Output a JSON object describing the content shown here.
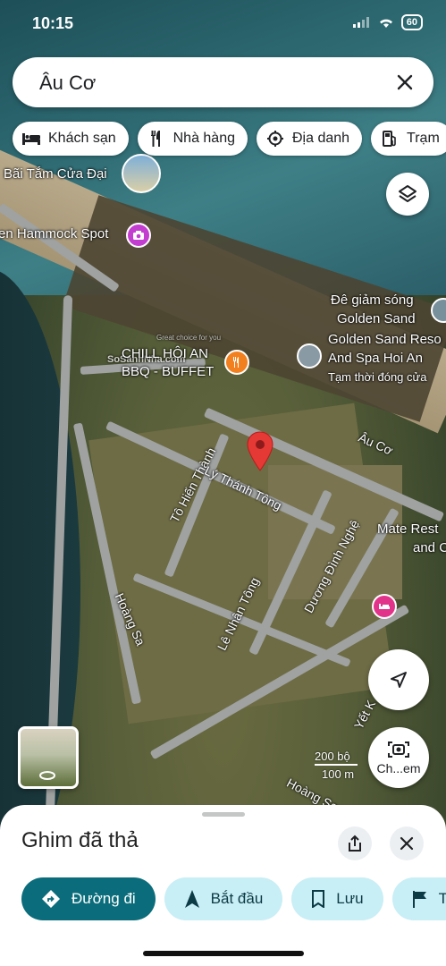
{
  "status_bar": {
    "time": "10:15",
    "battery": "60"
  },
  "search": {
    "query": "Âu Cơ"
  },
  "chips": [
    {
      "label": "Khách sạn",
      "icon": "bed-icon"
    },
    {
      "label": "Nhà hàng",
      "icon": "restaurant-icon"
    },
    {
      "label": "Địa danh",
      "icon": "landmark-icon"
    },
    {
      "label": "Trạm",
      "icon": "gas-station-icon"
    }
  ],
  "map": {
    "places": {
      "beach": "Bãi Tắm Cửa Đại",
      "hammock": "en Hammock Spot",
      "chill_line1": "CHILL HỘI AN",
      "chill_line2": "BBQ - BUFFET",
      "breakwater_line1": "Đê giảm sóng",
      "breakwater_line2": "Golden Sand",
      "resort_line1": "Golden Sand Reso",
      "resort_line2": "And Spa Hoi An",
      "resort_status": "Tạm thời đóng cửa",
      "mate_line1": "Mate Rest",
      "mate_line2": "and C"
    },
    "streets": {
      "au_co": "Âu Cơ",
      "to_hien_thanh": "Tô Hiến Thành",
      "ly_thanh_tong": "Lý Thánh Tông",
      "duong_dinh_nghe": "Dương Đình Nghệ",
      "hoang_sa": "Hoàng Sa",
      "le_nhan_tong": "Lê Nhân Tông",
      "yet_kieu": "Yết K",
      "hoang_sa_bottom": "Hoàng Sa"
    },
    "watermark": "SoSanhNha.com",
    "watermark_sub": "Great choice for you",
    "scale": {
      "top": "200 bộ",
      "bottom": "100 m"
    },
    "camera_label": "Ch...em"
  },
  "sheet": {
    "title": "Ghim đã thả",
    "actions": [
      {
        "label": "Đường đi",
        "icon": "directions-icon"
      },
      {
        "label": "Bắt đầu",
        "icon": "navigation-arrow-icon"
      },
      {
        "label": "Lưu",
        "icon": "bookmark-icon"
      },
      {
        "label": "T",
        "icon": "flag-icon"
      }
    ]
  }
}
